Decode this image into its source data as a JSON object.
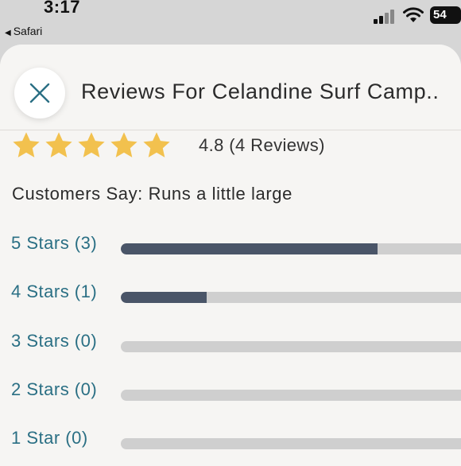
{
  "status_bar": {
    "time": "3:17",
    "back_label": "Safari",
    "battery": "54"
  },
  "sheet": {
    "title": "Reviews For Celandine Surf Camp..",
    "close_icon": "close-icon"
  },
  "rating": {
    "stars_filled": 5,
    "summary": "4.8 (4 Reviews)"
  },
  "customers_say": "Customers Say: Runs a little large",
  "distribution": [
    {
      "label": "5 Stars (3)",
      "fraction": 0.75
    },
    {
      "label": "4 Stars (1)",
      "fraction": 0.25
    },
    {
      "label": "3 Stars (0)",
      "fraction": 0
    },
    {
      "label": "2 Stars (0)",
      "fraction": 0
    },
    {
      "label": "1 Star (0)",
      "fraction": 0
    }
  ],
  "colors": {
    "star": "#f2c14e",
    "bar_fill": "#4a5568",
    "bar_track": "#cfcfcf",
    "link_text": "#2a6f84",
    "close_icon": "#2a6f84"
  }
}
